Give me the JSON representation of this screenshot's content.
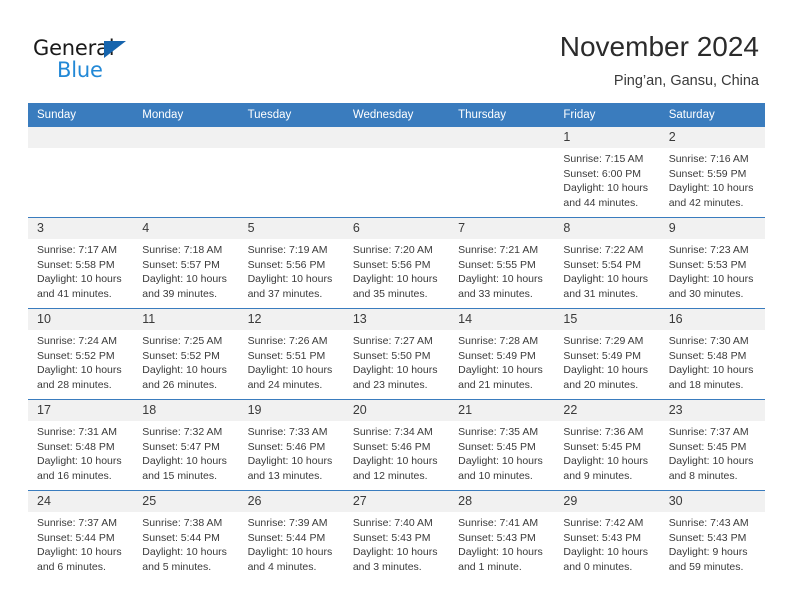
{
  "brand": {
    "name_part1": "General",
    "name_part2": "Blue",
    "triangle_color": "#1664ad",
    "blue_color": "#2288d6"
  },
  "header": {
    "title": "November 2024",
    "subtitle": "Ping’an, Gansu, China"
  },
  "theme": {
    "header_blue": "#3a7cbe",
    "daynum_band": "#f1f1f1",
    "text": "#3a3a3a"
  },
  "weekdays": [
    "Sunday",
    "Monday",
    "Tuesday",
    "Wednesday",
    "Thursday",
    "Friday",
    "Saturday"
  ],
  "weeks": [
    [
      {
        "day": "",
        "empty": true
      },
      {
        "day": "",
        "empty": true
      },
      {
        "day": "",
        "empty": true
      },
      {
        "day": "",
        "empty": true
      },
      {
        "day": "",
        "empty": true
      },
      {
        "day": "1",
        "sunrise": "Sunrise: 7:15 AM",
        "sunset": "Sunset: 6:00 PM",
        "daylight1": "Daylight: 10 hours",
        "daylight2": "and 44 minutes."
      },
      {
        "day": "2",
        "sunrise": "Sunrise: 7:16 AM",
        "sunset": "Sunset: 5:59 PM",
        "daylight1": "Daylight: 10 hours",
        "daylight2": "and 42 minutes."
      }
    ],
    [
      {
        "day": "3",
        "sunrise": "Sunrise: 7:17 AM",
        "sunset": "Sunset: 5:58 PM",
        "daylight1": "Daylight: 10 hours",
        "daylight2": "and 41 minutes."
      },
      {
        "day": "4",
        "sunrise": "Sunrise: 7:18 AM",
        "sunset": "Sunset: 5:57 PM",
        "daylight1": "Daylight: 10 hours",
        "daylight2": "and 39 minutes."
      },
      {
        "day": "5",
        "sunrise": "Sunrise: 7:19 AM",
        "sunset": "Sunset: 5:56 PM",
        "daylight1": "Daylight: 10 hours",
        "daylight2": "and 37 minutes."
      },
      {
        "day": "6",
        "sunrise": "Sunrise: 7:20 AM",
        "sunset": "Sunset: 5:56 PM",
        "daylight1": "Daylight: 10 hours",
        "daylight2": "and 35 minutes."
      },
      {
        "day": "7",
        "sunrise": "Sunrise: 7:21 AM",
        "sunset": "Sunset: 5:55 PM",
        "daylight1": "Daylight: 10 hours",
        "daylight2": "and 33 minutes."
      },
      {
        "day": "8",
        "sunrise": "Sunrise: 7:22 AM",
        "sunset": "Sunset: 5:54 PM",
        "daylight1": "Daylight: 10 hours",
        "daylight2": "and 31 minutes."
      },
      {
        "day": "9",
        "sunrise": "Sunrise: 7:23 AM",
        "sunset": "Sunset: 5:53 PM",
        "daylight1": "Daylight: 10 hours",
        "daylight2": "and 30 minutes."
      }
    ],
    [
      {
        "day": "10",
        "sunrise": "Sunrise: 7:24 AM",
        "sunset": "Sunset: 5:52 PM",
        "daylight1": "Daylight: 10 hours",
        "daylight2": "and 28 minutes."
      },
      {
        "day": "11",
        "sunrise": "Sunrise: 7:25 AM",
        "sunset": "Sunset: 5:52 PM",
        "daylight1": "Daylight: 10 hours",
        "daylight2": "and 26 minutes."
      },
      {
        "day": "12",
        "sunrise": "Sunrise: 7:26 AM",
        "sunset": "Sunset: 5:51 PM",
        "daylight1": "Daylight: 10 hours",
        "daylight2": "and 24 minutes."
      },
      {
        "day": "13",
        "sunrise": "Sunrise: 7:27 AM",
        "sunset": "Sunset: 5:50 PM",
        "daylight1": "Daylight: 10 hours",
        "daylight2": "and 23 minutes."
      },
      {
        "day": "14",
        "sunrise": "Sunrise: 7:28 AM",
        "sunset": "Sunset: 5:49 PM",
        "daylight1": "Daylight: 10 hours",
        "daylight2": "and 21 minutes."
      },
      {
        "day": "15",
        "sunrise": "Sunrise: 7:29 AM",
        "sunset": "Sunset: 5:49 PM",
        "daylight1": "Daylight: 10 hours",
        "daylight2": "and 20 minutes."
      },
      {
        "day": "16",
        "sunrise": "Sunrise: 7:30 AM",
        "sunset": "Sunset: 5:48 PM",
        "daylight1": "Daylight: 10 hours",
        "daylight2": "and 18 minutes."
      }
    ],
    [
      {
        "day": "17",
        "sunrise": "Sunrise: 7:31 AM",
        "sunset": "Sunset: 5:48 PM",
        "daylight1": "Daylight: 10 hours",
        "daylight2": "and 16 minutes."
      },
      {
        "day": "18",
        "sunrise": "Sunrise: 7:32 AM",
        "sunset": "Sunset: 5:47 PM",
        "daylight1": "Daylight: 10 hours",
        "daylight2": "and 15 minutes."
      },
      {
        "day": "19",
        "sunrise": "Sunrise: 7:33 AM",
        "sunset": "Sunset: 5:46 PM",
        "daylight1": "Daylight: 10 hours",
        "daylight2": "and 13 minutes."
      },
      {
        "day": "20",
        "sunrise": "Sunrise: 7:34 AM",
        "sunset": "Sunset: 5:46 PM",
        "daylight1": "Daylight: 10 hours",
        "daylight2": "and 12 minutes."
      },
      {
        "day": "21",
        "sunrise": "Sunrise: 7:35 AM",
        "sunset": "Sunset: 5:45 PM",
        "daylight1": "Daylight: 10 hours",
        "daylight2": "and 10 minutes."
      },
      {
        "day": "22",
        "sunrise": "Sunrise: 7:36 AM",
        "sunset": "Sunset: 5:45 PM",
        "daylight1": "Daylight: 10 hours",
        "daylight2": "and 9 minutes."
      },
      {
        "day": "23",
        "sunrise": "Sunrise: 7:37 AM",
        "sunset": "Sunset: 5:45 PM",
        "daylight1": "Daylight: 10 hours",
        "daylight2": "and 8 minutes."
      }
    ],
    [
      {
        "day": "24",
        "sunrise": "Sunrise: 7:37 AM",
        "sunset": "Sunset: 5:44 PM",
        "daylight1": "Daylight: 10 hours",
        "daylight2": "and 6 minutes."
      },
      {
        "day": "25",
        "sunrise": "Sunrise: 7:38 AM",
        "sunset": "Sunset: 5:44 PM",
        "daylight1": "Daylight: 10 hours",
        "daylight2": "and 5 minutes."
      },
      {
        "day": "26",
        "sunrise": "Sunrise: 7:39 AM",
        "sunset": "Sunset: 5:44 PM",
        "daylight1": "Daylight: 10 hours",
        "daylight2": "and 4 minutes."
      },
      {
        "day": "27",
        "sunrise": "Sunrise: 7:40 AM",
        "sunset": "Sunset: 5:43 PM",
        "daylight1": "Daylight: 10 hours",
        "daylight2": "and 3 minutes."
      },
      {
        "day": "28",
        "sunrise": "Sunrise: 7:41 AM",
        "sunset": "Sunset: 5:43 PM",
        "daylight1": "Daylight: 10 hours",
        "daylight2": "and 1 minute."
      },
      {
        "day": "29",
        "sunrise": "Sunrise: 7:42 AM",
        "sunset": "Sunset: 5:43 PM",
        "daylight1": "Daylight: 10 hours",
        "daylight2": "and 0 minutes."
      },
      {
        "day": "30",
        "sunrise": "Sunrise: 7:43 AM",
        "sunset": "Sunset: 5:43 PM",
        "daylight1": "Daylight: 9 hours",
        "daylight2": "and 59 minutes."
      }
    ]
  ]
}
